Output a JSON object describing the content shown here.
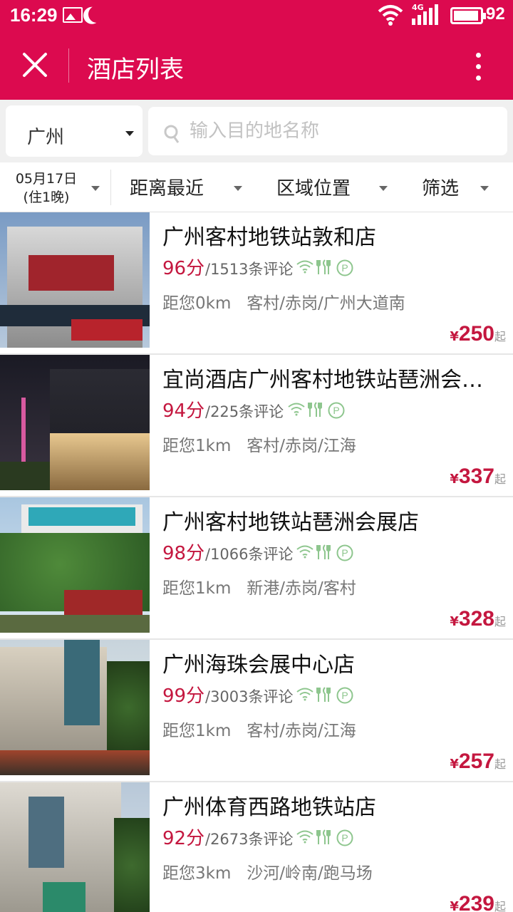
{
  "status_bar": {
    "time": "16:29",
    "network": "4G",
    "battery": "92"
  },
  "app_bar": {
    "title": "酒店列表",
    "close_icon": "close-icon",
    "more_icon": "more-vertical-icon"
  },
  "search": {
    "city": "广州",
    "placeholder": "输入目的地名称",
    "value": ""
  },
  "filters": {
    "date_line1": "05月17日",
    "date_line2": "(住1晚)",
    "sort": "距离最近",
    "area": "区域位置",
    "filter": "筛选"
  },
  "colors": {
    "brand": "#dc0a4f",
    "price": "#c4173f",
    "amenity": "#8ec68e"
  },
  "hotels": [
    {
      "name": "广州客村地铁站敦和店",
      "score": "96分",
      "reviews": "/1513条评论",
      "distance": "距您0km",
      "area": "客村/赤岗/广州大道南",
      "price_symbol": "¥",
      "price": "250",
      "price_suffix": "起",
      "amenities": [
        "wifi-icon",
        "restaurant-icon",
        "parking-icon"
      ]
    },
    {
      "name": "宜尚酒店广州客村地铁站琶洲会展中心店",
      "score": "94分",
      "reviews": "/225条评论",
      "distance": "距您1km",
      "area": "客村/赤岗/江海",
      "price_symbol": "¥",
      "price": "337",
      "price_suffix": "起",
      "amenities": [
        "wifi-icon",
        "restaurant-icon",
        "parking-icon"
      ]
    },
    {
      "name": "广州客村地铁站琶洲会展店",
      "score": "98分",
      "reviews": "/1066条评论",
      "distance": "距您1km",
      "area": "新港/赤岗/客村",
      "price_symbol": "¥",
      "price": "328",
      "price_suffix": "起",
      "amenities": [
        "wifi-icon",
        "restaurant-icon",
        "parking-icon"
      ]
    },
    {
      "name": "广州海珠会展中心店",
      "score": "99分",
      "reviews": "/3003条评论",
      "distance": "距您1km",
      "area": "客村/赤岗/江海",
      "price_symbol": "¥",
      "price": "257",
      "price_suffix": "起",
      "amenities": [
        "wifi-icon",
        "restaurant-icon",
        "parking-icon"
      ]
    },
    {
      "name": "广州体育西路地铁站店",
      "score": "92分",
      "reviews": "/2673条评论",
      "distance": "距您3km",
      "area": "沙河/岭南/跑马场",
      "price_symbol": "¥",
      "price": "239",
      "price_suffix": "起",
      "amenities": [
        "wifi-icon",
        "restaurant-icon",
        "parking-icon"
      ]
    }
  ]
}
